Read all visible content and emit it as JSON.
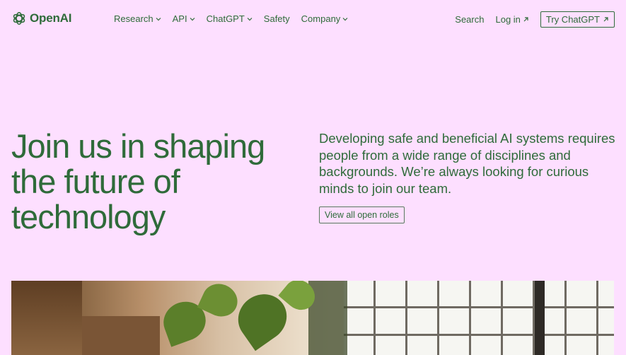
{
  "brand": {
    "name": "OpenAI",
    "accent": "#2f6b3a",
    "background": "#fddfff"
  },
  "nav": {
    "items": [
      {
        "label": "Research",
        "dropdown": true
      },
      {
        "label": "API",
        "dropdown": true
      },
      {
        "label": "ChatGPT",
        "dropdown": true
      },
      {
        "label": "Safety",
        "dropdown": false
      },
      {
        "label": "Company",
        "dropdown": true
      }
    ],
    "search": "Search",
    "login": "Log in",
    "try": "Try ChatGPT"
  },
  "hero": {
    "title": "Join us in shaping the future of technology",
    "description": "Developing safe and beneficial AI systems requires people from a wide range of disciplines and backgrounds. We’re always looking for curious minds to join our team.",
    "cta": "View all open roles"
  },
  "icons": {
    "logo": "openai-logo-icon",
    "chevron": "chevron-down-icon",
    "external": "arrow-up-right-icon"
  }
}
